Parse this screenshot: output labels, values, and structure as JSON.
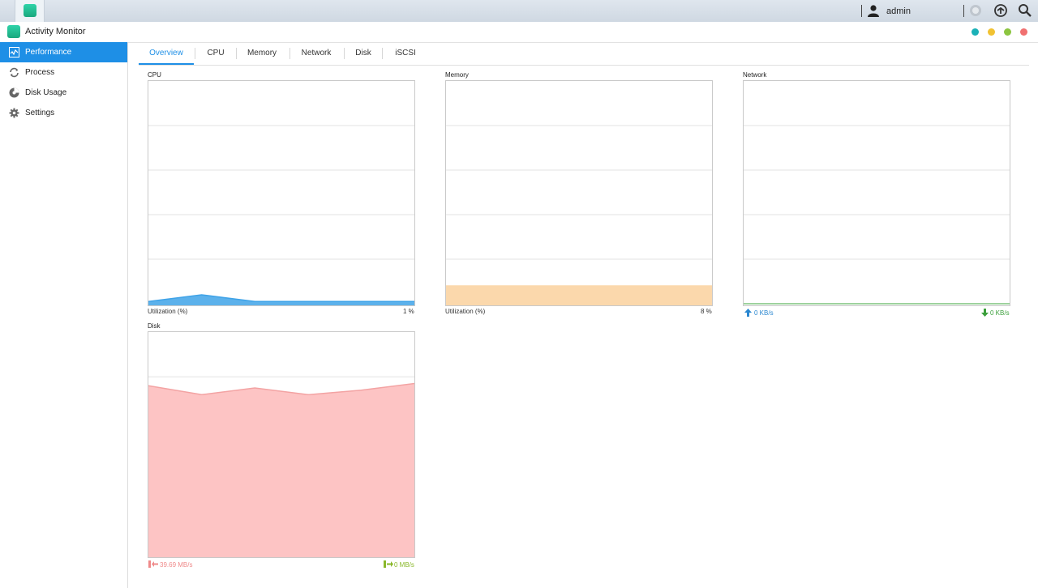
{
  "topbar": {
    "user_name": "admin"
  },
  "window": {
    "title": "Activity Monitor"
  },
  "colors": {
    "accent": "#1e8fe6",
    "dot_teal": "#1bb1b7",
    "dot_yellow": "#f1c232",
    "dot_green": "#8cc540",
    "dot_red": "#f07070",
    "cpu_fill": "#3fa3e8",
    "mem_fill": "#fbd8ac",
    "net_line": "#7fc47f",
    "disk_fill": "#fdc4c4"
  },
  "sidebar": {
    "items": [
      {
        "label": "Performance",
        "icon": "performance-icon",
        "active": true
      },
      {
        "label": "Process",
        "icon": "process-icon",
        "active": false
      },
      {
        "label": "Disk Usage",
        "icon": "disk-usage-icon",
        "active": false
      },
      {
        "label": "Settings",
        "icon": "gear-icon",
        "active": false
      }
    ]
  },
  "tabs": [
    {
      "label": "Overview",
      "active": true
    },
    {
      "label": "CPU",
      "active": false
    },
    {
      "label": "Memory",
      "active": false
    },
    {
      "label": "Network",
      "active": false
    },
    {
      "label": "Disk",
      "active": false
    },
    {
      "label": "iSCSI",
      "active": false
    }
  ],
  "panels": {
    "cpu": {
      "title": "CPU",
      "foot_left": "Utilization (%)",
      "foot_right": "1 %"
    },
    "memory": {
      "title": "Memory",
      "foot_left": "Utilization (%)",
      "foot_right": "8 %"
    },
    "network": {
      "title": "Network",
      "foot_left": "0 KB/s",
      "foot_right": "0 KB/s"
    },
    "disk": {
      "title": "Disk",
      "foot_left": "39.69 MB/s",
      "foot_right": "0 MB/s"
    }
  },
  "chart_data": [
    {
      "type": "area",
      "title": "CPU",
      "ylabel": "Utilization (%)",
      "ylim": [
        0,
        100
      ],
      "grid": true,
      "series": [
        {
          "values": [
            1,
            4,
            1,
            1,
            1,
            1
          ]
        }
      ]
    },
    {
      "type": "area",
      "title": "Memory",
      "ylabel": "Utilization (%)",
      "ylim": [
        0,
        100
      ],
      "grid": true,
      "series": [
        {
          "values": [
            8,
            8,
            8,
            8,
            8,
            8
          ]
        }
      ]
    },
    {
      "type": "line",
      "title": "Network",
      "ylim": [
        0,
        100
      ],
      "grid": true,
      "series": [
        {
          "values": [
            0,
            0,
            0,
            0,
            0,
            0
          ]
        }
      ]
    },
    {
      "type": "area",
      "title": "Disk",
      "ylim": [
        0,
        100
      ],
      "grid": true,
      "series": [
        {
          "values": [
            76,
            72,
            75,
            72,
            74,
            77
          ]
        }
      ]
    }
  ]
}
